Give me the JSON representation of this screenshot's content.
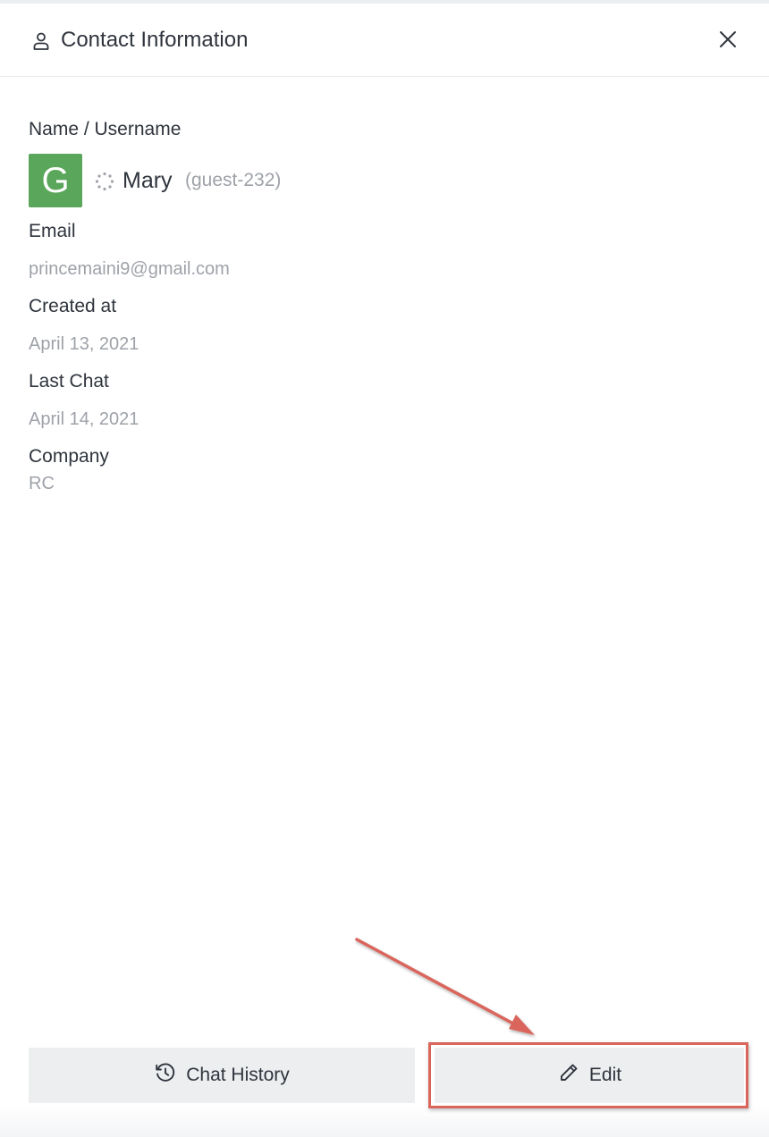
{
  "header": {
    "title": "Contact Information",
    "icons": {
      "user": "user-icon",
      "close": "close-icon"
    }
  },
  "contact": {
    "name_label": "Name / Username",
    "avatar_letter": "G",
    "avatar_color": "#5aa65a",
    "status_icon": "status-loading-icon",
    "display_name": "Mary",
    "username": "(guest-232)",
    "email_label": "Email",
    "email": "princemaini9@gmail.com",
    "created_label": "Created at",
    "created": "April 13, 2021",
    "last_chat_label": "Last Chat",
    "last_chat": "April 14, 2021",
    "company_label": "Company",
    "company": "RC"
  },
  "footer": {
    "chat_history_label": "Chat History",
    "chat_history_icon": "history-icon",
    "edit_label": "Edit",
    "edit_icon": "pencil-icon"
  },
  "annotation": {
    "highlight_color": "#d9655b",
    "target": "edit-button"
  }
}
